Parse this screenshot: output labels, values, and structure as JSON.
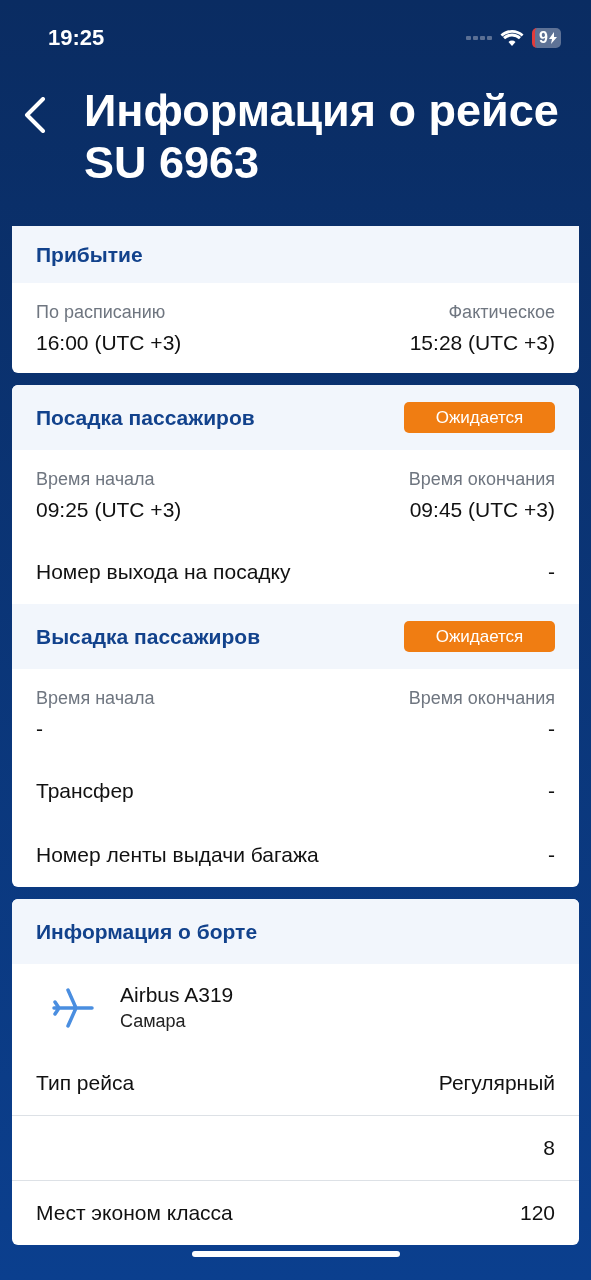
{
  "status_bar": {
    "time": "19:25",
    "battery": "9"
  },
  "header": {
    "title": "Информация о рейсе SU 6963"
  },
  "cards": [
    {
      "sections": [
        {
          "title": "Прибытие",
          "rows": [
            {
              "kind": "times",
              "divider": false,
              "left_label": "По расписанию",
              "left_value": "16:00 (UTC +3)",
              "right_label": "Фактическое",
              "right_value": "15:28 (UTC +3)"
            }
          ]
        }
      ]
    },
    {
      "sections": [
        {
          "title": "Посадка пассажиров",
          "badge": "Ожидается",
          "rows": [
            {
              "kind": "times",
              "divider": false,
              "left_label": "Время начала",
              "left_value": "09:25 (UTC +3)",
              "right_label": "Время окончания",
              "right_value": "09:45 (UTC +3)"
            },
            {
              "kind": "pair",
              "divider": false,
              "label": "Номер выхода на посадку",
              "value": "-"
            }
          ]
        },
        {
          "title": "Высадка пассажиров",
          "badge": "Ожидается",
          "rows": [
            {
              "kind": "times",
              "divider": false,
              "left_label": "Время начала",
              "left_value": "-",
              "right_label": "Время окончания",
              "right_value": "-"
            },
            {
              "kind": "pair",
              "divider": false,
              "label": "Трансфер",
              "value": "-"
            },
            {
              "kind": "pair",
              "divider": false,
              "label": "Номер ленты выдачи багажа",
              "value": "-"
            }
          ]
        }
      ]
    },
    {
      "sections": [
        {
          "title": "Информация о борте",
          "rows": [
            {
              "kind": "aircraft",
              "divider": false,
              "model": "Airbus A319",
              "city": "Самара"
            },
            {
              "kind": "pair",
              "divider": false,
              "label": "Тип рейса",
              "value": "Регулярный"
            },
            {
              "kind": "pair",
              "divider": true,
              "value": "8"
            },
            {
              "kind": "pair",
              "divider": true,
              "label": "Мест эконом класса",
              "value": "120"
            }
          ]
        }
      ]
    }
  ]
}
